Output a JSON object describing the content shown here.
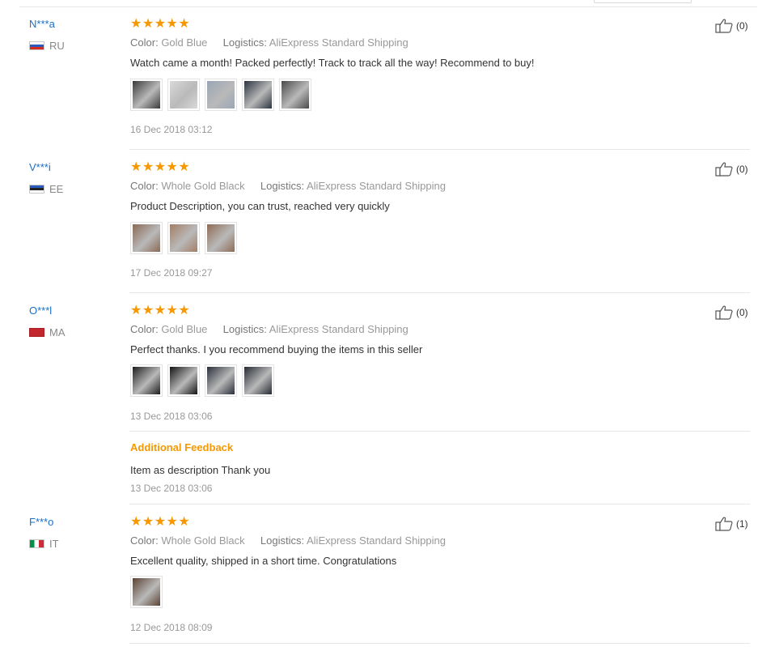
{
  "reviews": [
    {
      "user": "N***a",
      "country": "RU",
      "flag": "flag-ru",
      "stars": "★★★★★",
      "color_label": "Color:",
      "color_value": "Gold Blue",
      "logistics_label": "Logistics:",
      "logistics_value": "AliExpress Standard Shipping",
      "text": "Watch came a month! Packed perfectly! Track to track all the way! Recommend to buy!",
      "date": "16 Dec 2018 03:12",
      "likes": "(0)",
      "photo_colors": [
        "#3b3b3b",
        "#d9d9d9",
        "#9aa6b5",
        "#2c3440",
        "#4a4a4a"
      ]
    },
    {
      "user": "V***i",
      "country": "EE",
      "flag": "flag-ee",
      "stars": "★★★★★",
      "color_label": "Color:",
      "color_value": "Whole Gold Black",
      "logistics_label": "Logistics:",
      "logistics_value": "AliExpress Standard Shipping",
      "text": "Product Description, you can trust, reached very quickly",
      "date": "17 Dec 2018 09:27",
      "likes": "(0)",
      "photo_colors": [
        "#8b6a55",
        "#a37e66",
        "#8f6c56"
      ]
    },
    {
      "user": "O***l",
      "country": "MA",
      "flag": "flag-ma",
      "stars": "★★★★★",
      "color_label": "Color:",
      "color_value": "Gold Blue",
      "logistics_label": "Logistics:",
      "logistics_value": "AliExpress Standard Shipping",
      "text": "Perfect thanks. I you recommend buying the items in this seller",
      "date": "13 Dec 2018 03:06",
      "likes": "(0)",
      "photo_colors": [
        "#1e1e1e",
        "#151515",
        "#2a2f3a",
        "#262a33"
      ],
      "additional_title": "Additional Feedback",
      "additional_text": "Item as description Thank you",
      "additional_date": "13 Dec 2018 03:06"
    },
    {
      "user": "F***o",
      "country": "IT",
      "flag": "flag-it",
      "stars": "★★★★★",
      "color_label": "Color:",
      "color_value": "Whole Gold Black",
      "logistics_label": "Logistics:",
      "logistics_value": "AliExpress Standard Shipping",
      "text": "Excellent quality, shipped in a short time. Congratulations",
      "date": "12 Dec 2018 08:09",
      "likes": "(1)",
      "photo_colors": [
        "#5b4334"
      ]
    }
  ]
}
